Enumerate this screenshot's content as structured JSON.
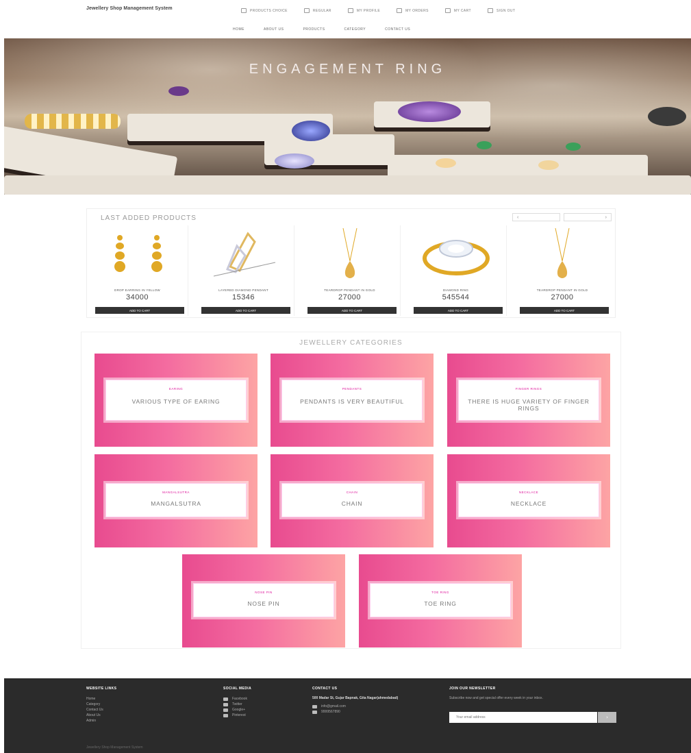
{
  "header": {
    "brand": "Jewellery Shop Management System",
    "top_links": [
      {
        "label": "PRODUCTS CHOICE",
        "icon": "list-icon"
      },
      {
        "label": "REGULAR",
        "icon": "tag-icon"
      },
      {
        "label": "MY PROFILE",
        "icon": "user-icon"
      },
      {
        "label": "MY ORDERS",
        "icon": "box-icon"
      },
      {
        "label": "MY CART",
        "icon": "cart-icon"
      },
      {
        "label": "SIGN OUT",
        "icon": "signout-icon"
      }
    ],
    "nav": [
      "HOME",
      "ABOUT US",
      "PRODUCTS",
      "CATEGORY",
      "CONTACT US"
    ]
  },
  "hero": {
    "title": "ENGAGEMENT RING"
  },
  "products": {
    "title": "LAST ADDED PRODUCTS",
    "prev_label": "‹",
    "next_label": "›",
    "items": [
      {
        "name": "DROP EARRING IN YELLOW",
        "price": "34000",
        "button": "ADD TO CART"
      },
      {
        "name": "LAYERED DIAMOND PENDANT",
        "price": "15346",
        "button": "ADD TO CART"
      },
      {
        "name": "TEARDROP PENDANT IN GOLD",
        "price": "27000",
        "button": "ADD TO CART"
      },
      {
        "name": "DIAMOND RING",
        "price": "545544",
        "button": "ADD TO CART"
      },
      {
        "name": "TEARDROP PENDANT IN GOLD",
        "price": "27000",
        "button": "ADD TO CART"
      }
    ]
  },
  "categories": {
    "title": "JEWELLERY CATEGORIES",
    "items": [
      {
        "name": "EARING",
        "desc": "VARIOUS TYPE OF EARING"
      },
      {
        "name": "PENDANTS",
        "desc": "PENDANTS IS VERY BEAUTIFUL"
      },
      {
        "name": "FINGER RINGS",
        "desc": "THERE IS HUGE VARIETY OF FINGER RINGS"
      },
      {
        "name": "MANGALSUTRA",
        "desc": "MANGALSUTRA"
      },
      {
        "name": "CHAIN",
        "desc": "CHAIN"
      },
      {
        "name": "NECKLACE",
        "desc": "NECKLACE"
      },
      {
        "name": "NOSE PIN",
        "desc": "NOSE PIN"
      },
      {
        "name": "TOE RING",
        "desc": "TOE RING"
      }
    ]
  },
  "footer": {
    "website_links": {
      "title": "WEBSITE LINKS",
      "items": [
        "Home",
        "Category",
        "Contact Us",
        "About Us",
        "Admin"
      ]
    },
    "social": {
      "title": "SOCIAL MEDIA",
      "items": [
        "Facebook",
        "Twitter",
        "Google+",
        "Pinterest"
      ]
    },
    "contact": {
      "title": "CONTACT US",
      "address": "500 Madar St, Gujar Bapnak, Gita Nagar(ahmedabad)",
      "email": "info@gmail.com",
      "phone": "9999567890"
    },
    "newsletter": {
      "title": "JOIN OUR NEWSLETTER",
      "text": "Subscribe now and get special offer every week in your inbox.",
      "placeholder": "Your email address",
      "button": "›"
    },
    "copyright": "Jewellery Shop Management System"
  }
}
